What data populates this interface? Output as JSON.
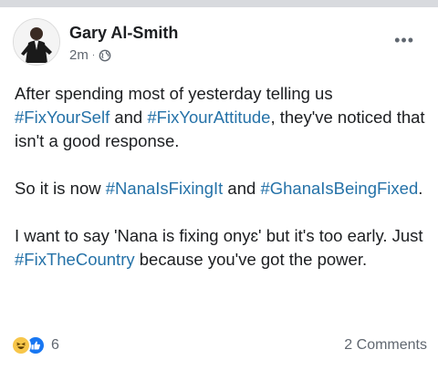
{
  "post": {
    "author_name": "Gary Al-Smith",
    "timestamp": "2m",
    "meta_separator": "·",
    "audience_icon": "globe-icon",
    "more_icon": "more-options-icon",
    "more_glyph": "•••",
    "paragraphs": [
      [
        {
          "text": "After spending most of yesterday telling us ",
          "hashtag": false
        },
        {
          "text": "#FixYourSelf",
          "hashtag": true
        },
        {
          "text": " and ",
          "hashtag": false
        },
        {
          "text": "#FixYourAttitude",
          "hashtag": true
        },
        {
          "text": ", they've noticed that isn't a good response.",
          "hashtag": false
        }
      ],
      [
        {
          "text": "So it is now ",
          "hashtag": false
        },
        {
          "text": "#NanaIsFixingIt",
          "hashtag": true
        },
        {
          "text": " and ",
          "hashtag": false
        },
        {
          "text": "#GhanaIsBeingFixed",
          "hashtag": true
        },
        {
          "text": ".",
          "hashtag": false
        }
      ],
      [
        {
          "text": "I want to say 'Nana is fixing onyɛ' but it's too early. Just ",
          "hashtag": false
        },
        {
          "text": "#FixTheCountry",
          "hashtag": true
        },
        {
          "text": " because you've got the power.",
          "hashtag": false
        }
      ]
    ],
    "reactions": {
      "icons": [
        "haha-icon",
        "like-icon"
      ],
      "count": "6"
    },
    "comments_label": "2 Comments"
  },
  "colors": {
    "hashtag": "#2572a8",
    "like": "#1877f2",
    "haha": "#f7c64a",
    "meta_text": "#606770"
  }
}
